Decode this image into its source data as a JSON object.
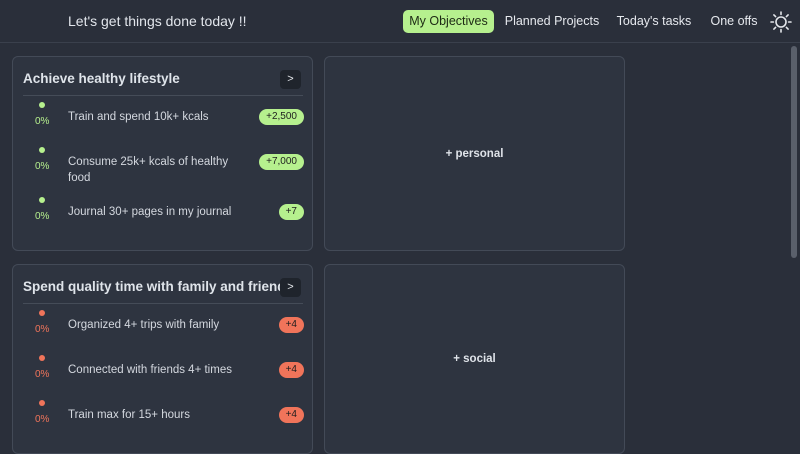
{
  "header": {
    "greeting": "Let's get things done today !!"
  },
  "nav": [
    {
      "label": "My Objectives",
      "active": true
    },
    {
      "label": "Planned Projects",
      "active": false
    },
    {
      "label": "Today's tasks",
      "active": false
    },
    {
      "label": "One offs",
      "active": false
    }
  ],
  "theme_toggle": {
    "icon": "sun-icon"
  },
  "colors": {
    "green": "#b6f08e",
    "orange": "#f0745a",
    "bg": "#2a2f3a",
    "card": "#2e3440"
  },
  "objectives": [
    {
      "title": "Achieve healthy lifestyle",
      "expand": ">",
      "add_label": "+ personal",
      "key_results": [
        {
          "progress": "0%",
          "text": "Train and spend 10k+ kcals",
          "badge": "+2,500"
        },
        {
          "progress": "0%",
          "text": "Consume 25k+ kcals of healthy food",
          "badge": "+7,000"
        },
        {
          "progress": "0%",
          "text": "Journal 30+ pages in my journal",
          "badge": "+7"
        }
      ]
    },
    {
      "title": "Spend quality time with family and friends",
      "expand": ">",
      "add_label": "+ social",
      "key_results": [
        {
          "progress": "0%",
          "text": "Organized 4+ trips with family",
          "badge": "+4"
        },
        {
          "progress": "0%",
          "text": "Connected with friends 4+ times",
          "badge": "+4"
        },
        {
          "progress": "0%",
          "text": "Train max for 15+ hours",
          "badge": "+4"
        }
      ]
    }
  ]
}
